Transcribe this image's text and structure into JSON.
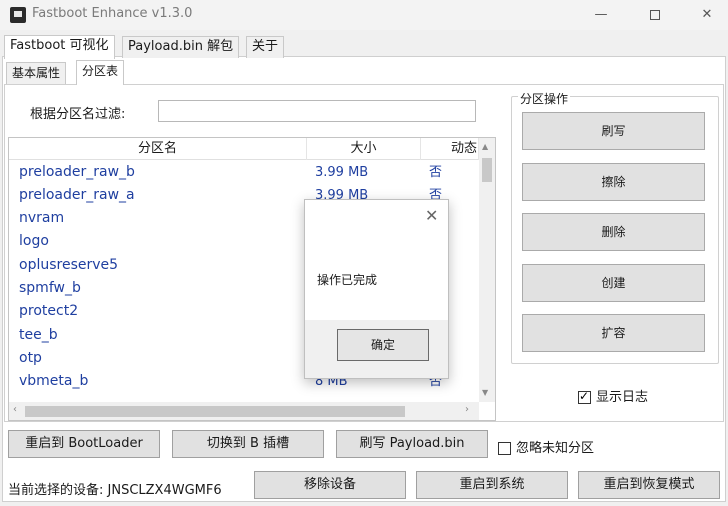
{
  "window": {
    "title": "Fastboot Enhance v1.3.0",
    "minimize": "—",
    "close": "✕"
  },
  "main_tabs": [
    {
      "label": "Fastboot 可视化"
    },
    {
      "label": "Payload.bin 解包"
    },
    {
      "label": "关于"
    }
  ],
  "sub_tabs": [
    {
      "label": "基本属性"
    },
    {
      "label": "分区表"
    }
  ],
  "filter": {
    "label": "根据分区名过滤:",
    "value": ""
  },
  "table": {
    "columns": [
      "分区名",
      "大小",
      "动态"
    ],
    "rows": [
      {
        "name": "preloader_raw_b",
        "size": "3.99 MB",
        "dynamic": "否"
      },
      {
        "name": "preloader_raw_a",
        "size": "3.99 MB",
        "dynamic": "否"
      },
      {
        "name": "nvram",
        "size": "",
        "dynamic": ""
      },
      {
        "name": "logo",
        "size": "",
        "dynamic": ""
      },
      {
        "name": "oplusreserve5",
        "size": "",
        "dynamic": ""
      },
      {
        "name": "spmfw_b",
        "size": "",
        "dynamic": ""
      },
      {
        "name": "protect2",
        "size": "",
        "dynamic": ""
      },
      {
        "name": "tee_b",
        "size": "",
        "dynamic": ""
      },
      {
        "name": "otp",
        "size": "",
        "dynamic": ""
      },
      {
        "name": "vbmeta_b",
        "size": "8 MB",
        "dynamic": "否"
      }
    ]
  },
  "partition_ops": {
    "title": "分区操作",
    "buttons": [
      "刷写",
      "擦除",
      "删除",
      "创建",
      "扩容"
    ]
  },
  "show_log": {
    "label": "显示日志",
    "checked": true
  },
  "bottom": {
    "reboot_bootloader": "重启到 BootLoader",
    "switch_slot": "切换到 B 插槽",
    "flash_payload": "刷写 Payload.bin",
    "ignore_unknown": "忽略未知分区",
    "device_label": "当前选择的设备: JNSCLZX4WGMF6",
    "remove_device": "移除设备",
    "reboot_system": "重启到系统",
    "reboot_recovery": "重启到恢复模式"
  },
  "dialog": {
    "message": "操作已完成",
    "ok": "确定",
    "close": "✕"
  }
}
